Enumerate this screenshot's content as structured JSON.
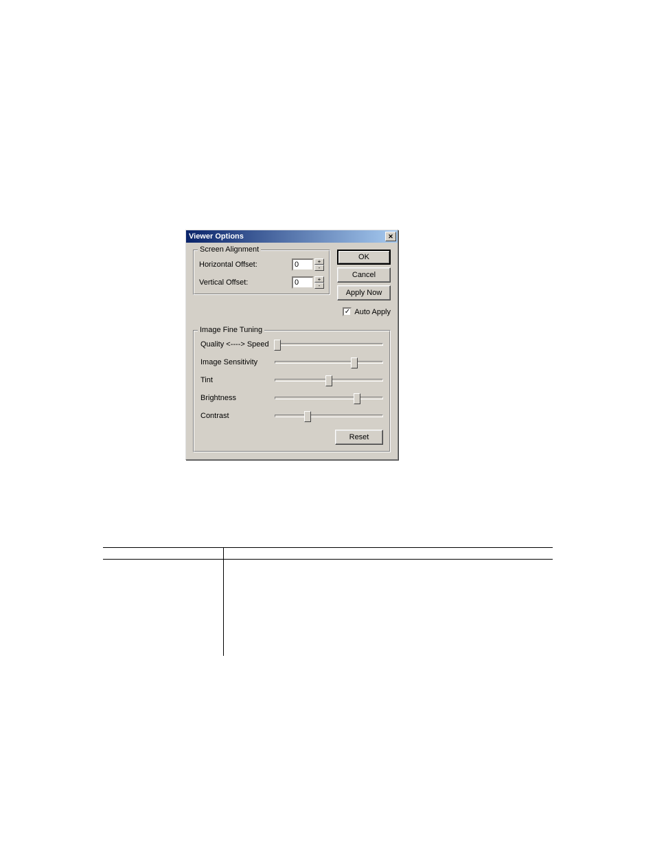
{
  "dialog": {
    "title": "Viewer Options",
    "close_glyph": "✕",
    "screen_alignment": {
      "legend": "Screen Alignment",
      "horizontal_label": "Horizontal Offset:",
      "horizontal_value": "0",
      "vertical_label": "Vertical Offset:",
      "vertical_value": "0",
      "spin_plus": "+",
      "spin_minus": "-"
    },
    "buttons": {
      "ok": "OK",
      "cancel": "Cancel",
      "apply_now": "Apply Now"
    },
    "auto_apply": {
      "checked_glyph": "✓",
      "label": "Auto Apply"
    },
    "tuning": {
      "legend": "Image Fine Tuning",
      "sliders": [
        {
          "label": "Quality <----> Speed",
          "pos": 2
        },
        {
          "label": "Image Sensitivity",
          "pos": 74
        },
        {
          "label": "Tint",
          "pos": 50
        },
        {
          "label": "Brightness",
          "pos": 76
        },
        {
          "label": "Contrast",
          "pos": 30
        }
      ],
      "reset": "Reset"
    }
  },
  "doc_table": {
    "header_col1": "",
    "header_col2": "",
    "row1_col1": "",
    "row1_col2": ""
  }
}
